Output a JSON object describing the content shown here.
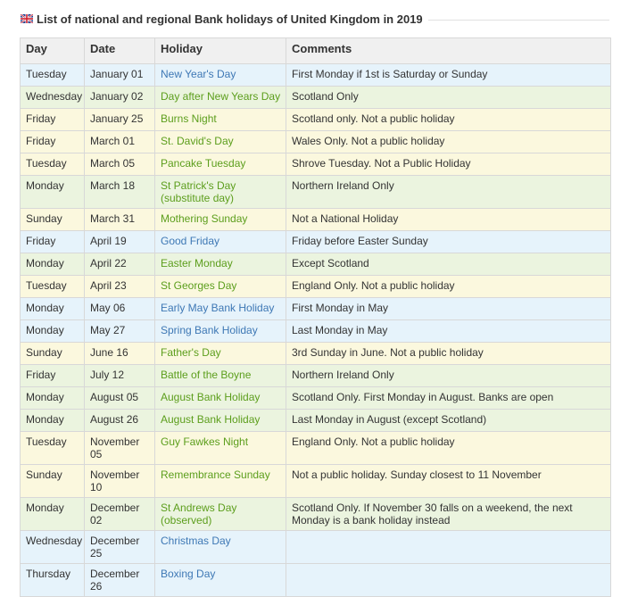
{
  "page": {
    "title": "List of national and regional Bank holidays of United Kingdom in 2019",
    "flag_icon": "uk-flag-icon"
  },
  "table": {
    "headers": [
      "Day",
      "Date",
      "Holiday",
      "Comments"
    ],
    "rows": [
      {
        "day": "Tuesday",
        "date": "January 01",
        "holiday": "New Year's Day",
        "comment": "First Monday if 1st is Saturday or Sunday",
        "row_color": "blue",
        "link_color": "blue"
      },
      {
        "day": "Wednesday",
        "date": "January 02",
        "holiday": "Day after New Years Day",
        "comment": "Scotland Only",
        "row_color": "green",
        "link_color": "green"
      },
      {
        "day": "Friday",
        "date": "January 25",
        "holiday": "Burns Night",
        "comment": "Scotland only. Not a public holiday",
        "row_color": "yellow",
        "link_color": "green"
      },
      {
        "day": "Friday",
        "date": "March 01",
        "holiday": "St. David's Day",
        "comment": "Wales Only. Not a public holiday",
        "row_color": "yellow",
        "link_color": "green"
      },
      {
        "day": "Tuesday",
        "date": "March 05",
        "holiday": "Pancake Tuesday",
        "comment": "Shrove Tuesday. Not a Public Holiday",
        "row_color": "yellow",
        "link_color": "green"
      },
      {
        "day": "Monday",
        "date": "March 18",
        "holiday": "St Patrick's Day (substitute day)",
        "comment": "Northern Ireland Only",
        "row_color": "green",
        "link_color": "green"
      },
      {
        "day": "Sunday",
        "date": "March 31",
        "holiday": "Mothering Sunday",
        "comment": "Not a National Holiday",
        "row_color": "yellow",
        "link_color": "green"
      },
      {
        "day": "Friday",
        "date": "April 19",
        "holiday": "Good Friday",
        "comment": "Friday before Easter Sunday",
        "row_color": "blue",
        "link_color": "blue"
      },
      {
        "day": "Monday",
        "date": "April 22",
        "holiday": "Easter Monday",
        "comment": "Except Scotland",
        "row_color": "green",
        "link_color": "green"
      },
      {
        "day": "Tuesday",
        "date": "April 23",
        "holiday": "St Georges Day",
        "comment": "England Only. Not a public holiday",
        "row_color": "yellow",
        "link_color": "green"
      },
      {
        "day": "Monday",
        "date": "May 06",
        "holiday": "Early May Bank Holiday",
        "comment": "First Monday in May",
        "row_color": "blue",
        "link_color": "blue"
      },
      {
        "day": "Monday",
        "date": "May 27",
        "holiday": "Spring Bank Holiday",
        "comment": "Last Monday in May",
        "row_color": "blue",
        "link_color": "blue"
      },
      {
        "day": "Sunday",
        "date": "June 16",
        "holiday": "Father's Day",
        "comment": "3rd Sunday in June. Not a public holiday",
        "row_color": "yellow",
        "link_color": "green"
      },
      {
        "day": "Friday",
        "date": "July 12",
        "holiday": "Battle of the Boyne",
        "comment": "Northern Ireland Only",
        "row_color": "green",
        "link_color": "green"
      },
      {
        "day": "Monday",
        "date": "August 05",
        "holiday": "August Bank Holiday",
        "comment": "Scotland Only. First Monday in August. Banks are open",
        "row_color": "green",
        "link_color": "green"
      },
      {
        "day": "Monday",
        "date": "August 26",
        "holiday": "August Bank Holiday",
        "comment": "Last Monday in August (except Scotland)",
        "row_color": "green",
        "link_color": "green"
      },
      {
        "day": "Tuesday",
        "date": "November 05",
        "holiday": "Guy Fawkes Night",
        "comment": "England Only. Not a public holiday",
        "row_color": "yellow",
        "link_color": "green"
      },
      {
        "day": "Sunday",
        "date": "November 10",
        "holiday": "Remembrance Sunday",
        "comment": "Not a public holiday. Sunday closest to 11 November",
        "row_color": "yellow",
        "link_color": "green"
      },
      {
        "day": "Monday",
        "date": "December 02",
        "holiday": "St Andrews Day (observed)",
        "comment": "Scotland Only. If November 30 falls on a weekend, the next Monday is a bank holiday instead",
        "row_color": "green",
        "link_color": "green"
      },
      {
        "day": "Wednesday",
        "date": "December 25",
        "holiday": "Christmas Day",
        "comment": "",
        "row_color": "blue",
        "link_color": "blue"
      },
      {
        "day": "Thursday",
        "date": "December 26",
        "holiday": "Boxing Day",
        "comment": "",
        "row_color": "blue",
        "link_color": "blue"
      }
    ]
  },
  "colors": {
    "row_blue": "#e6f3fb",
    "row_green": "#ebf4df",
    "row_yellow": "#fbf8de",
    "link_blue": "#3e78b5",
    "link_green": "#5c9e1c"
  }
}
